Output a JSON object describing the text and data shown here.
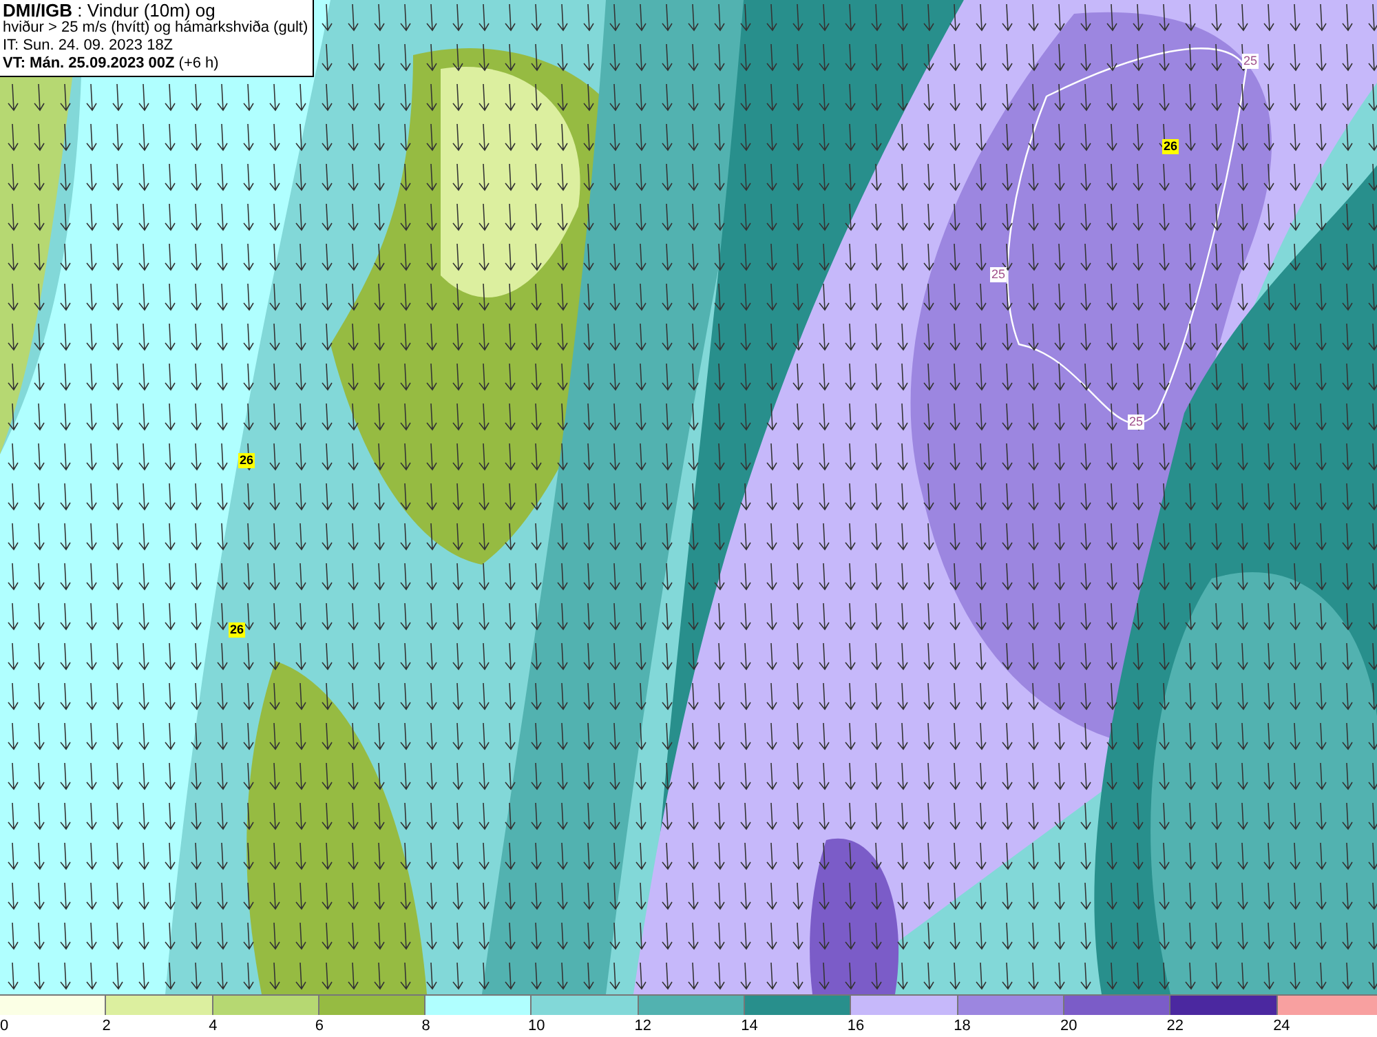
{
  "header": {
    "lines": [
      "**DMI/IGB** : Vindur (10m) og",
      "hviður > 25 m/s (hvítt) og hámarkshviða (gult)",
      "IT: Sun. 24. 09. 2023 18Z",
      "**VT: Mán. 25.09.2023 00Z** (+6 h)"
    ]
  },
  "map": {
    "labels": [
      {
        "kind": "gust",
        "text": "25"
      },
      {
        "kind": "max",
        "text": "26"
      },
      {
        "kind": "gust",
        "text": "25"
      },
      {
        "kind": "gust",
        "text": "25"
      },
      {
        "kind": "max",
        "text": "26"
      },
      {
        "kind": "max",
        "text": "26"
      }
    ]
  },
  "legend": [
    {
      "color": "#fbffe5",
      "tick": "0"
    },
    {
      "color": "#dcef9f",
      "tick": "2"
    },
    {
      "color": "#b6d872",
      "tick": "4"
    },
    {
      "color": "#96bb42",
      "tick": "6"
    },
    {
      "color": "#b0ffff",
      "tick": "8"
    },
    {
      "color": "#82d8d8",
      "tick": "10"
    },
    {
      "color": "#52b2b0",
      "tick": "12"
    },
    {
      "color": "#288f8c",
      "tick": "14"
    },
    {
      "color": "#c6b8fa",
      "tick": "16"
    },
    {
      "color": "#9c86e0",
      "tick": "18"
    },
    {
      "color": "#7b5cc8",
      "tick": "20"
    },
    {
      "color": "#4b28a0",
      "tick": "22"
    },
    {
      "color": "#f8a0a0",
      "tick": "24"
    }
  ]
}
